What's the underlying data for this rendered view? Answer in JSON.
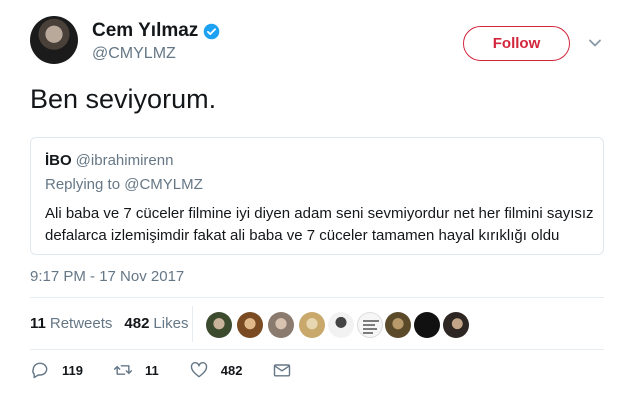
{
  "tweet": {
    "display_name": "Cem Yılmaz",
    "handle": "@CMYLMZ",
    "follow_label": "Follow",
    "text": "Ben seviyorum.",
    "timestamp": "9:17 PM - 17 Nov 2017",
    "verified": true,
    "accent_color": "#d2263c"
  },
  "quote": {
    "name": "İBO",
    "handle": "@ibrahimirenn",
    "replying_to": "Replying to @CMYLMZ",
    "text": "Ali baba ve 7 cüceler filmine iyi diyen adam seni sevmiyordur net her filmini sayısız defalarca izlemişimdir fakat ali baba ve 7 cüceler tamamen hayal kırıklığı oldu"
  },
  "stats": {
    "retweets_count": "11",
    "retweets_label": "Retweets",
    "likes_count": "482",
    "likes_label": "Likes"
  },
  "likers": [
    "avatar",
    "avatar",
    "avatar",
    "avatar",
    "avatar",
    "avatar",
    "avatar",
    "avatar",
    "avatar",
    "avatar"
  ],
  "actions": {
    "reply_count": "119",
    "retweet_count": "11",
    "like_count": "482"
  }
}
